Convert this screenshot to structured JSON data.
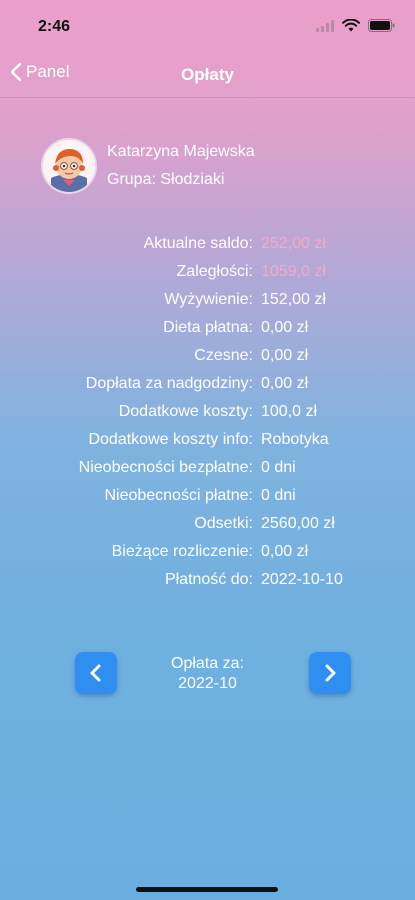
{
  "status_bar": {
    "time": "2:46"
  },
  "nav": {
    "back_label": "Panel",
    "title": "Opłaty"
  },
  "profile": {
    "name": "Katarzyna Majewska",
    "group": "Grupa: Słodziaki"
  },
  "details": [
    {
      "label": "Aktualne saldo:",
      "value": "252,00 zł",
      "faded": true
    },
    {
      "label": "Zaległości:",
      "value": "1059,0 zł",
      "faded": true
    },
    {
      "label": "Wyżywienie:",
      "value": "152,00 zł"
    },
    {
      "label": "Dieta płatna:",
      "value": "0,00 zł"
    },
    {
      "label": "Czesne:",
      "value": "0,00 zł"
    },
    {
      "label": "Dopłata za nadgodziny:",
      "value": "0,00 zł"
    },
    {
      "label": "Dodatkowe koszty:",
      "value": "100,0 zł"
    },
    {
      "label": "Dodatkowe koszty info:",
      "value": "Robotyka"
    },
    {
      "label": "Nieobecności bezpłatne:",
      "value": "0 dni"
    },
    {
      "label": "Nieobecności płatne:",
      "value": "0 dni"
    },
    {
      "label": "Odsetki:",
      "value": "2560,00 zł"
    },
    {
      "label": "Bieżące rozliczenie:",
      "value": "0,00 zł"
    },
    {
      "label": "Płatność do:",
      "value": "2022-10-10"
    }
  ],
  "pager": {
    "label_line1": "Opłata za:",
    "label_line2": "2022-10"
  },
  "colors": {
    "button": "#2e8ff0",
    "faded_value": "#f4a9c7"
  },
  "icons": {
    "back": "chevron-left-icon",
    "prev": "chevron-left-icon",
    "next": "chevron-right-icon"
  }
}
